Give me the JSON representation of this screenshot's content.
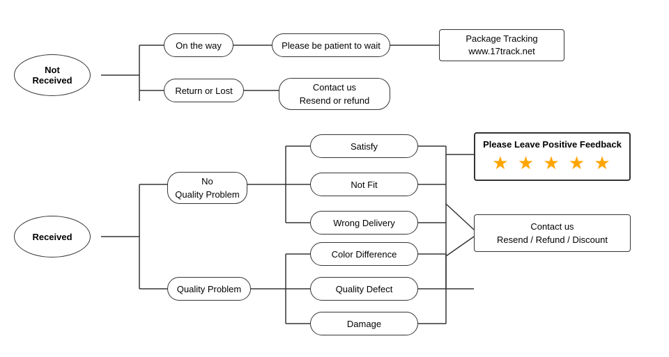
{
  "nodes": {
    "not_received": {
      "label": "Not\nReceived"
    },
    "on_the_way": {
      "label": "On the way"
    },
    "return_or_lost": {
      "label": "Return or Lost"
    },
    "please_be_patient": {
      "label": "Please be patient to wait"
    },
    "package_tracking": {
      "label": "Package Tracking\nwww.17track.net"
    },
    "contact_us_resend": {
      "label": "Contact us\nResend or refund"
    },
    "received": {
      "label": "Received"
    },
    "no_quality_problem": {
      "label": "No\nQuality Problem"
    },
    "quality_problem": {
      "label": "Quality Problem"
    },
    "satisfy": {
      "label": "Satisfy"
    },
    "not_fit": {
      "label": "Not Fit"
    },
    "wrong_delivery": {
      "label": "Wrong Delivery"
    },
    "color_difference": {
      "label": "Color Difference"
    },
    "quality_defect": {
      "label": "Quality Defect"
    },
    "damage": {
      "label": "Damage"
    },
    "please_leave_feedback": {
      "label": "Please Leave Positive Feedback"
    },
    "stars": {
      "label": "★ ★ ★ ★ ★"
    },
    "contact_us_refund": {
      "label": "Contact us\nResend / Refund / Discount"
    }
  }
}
